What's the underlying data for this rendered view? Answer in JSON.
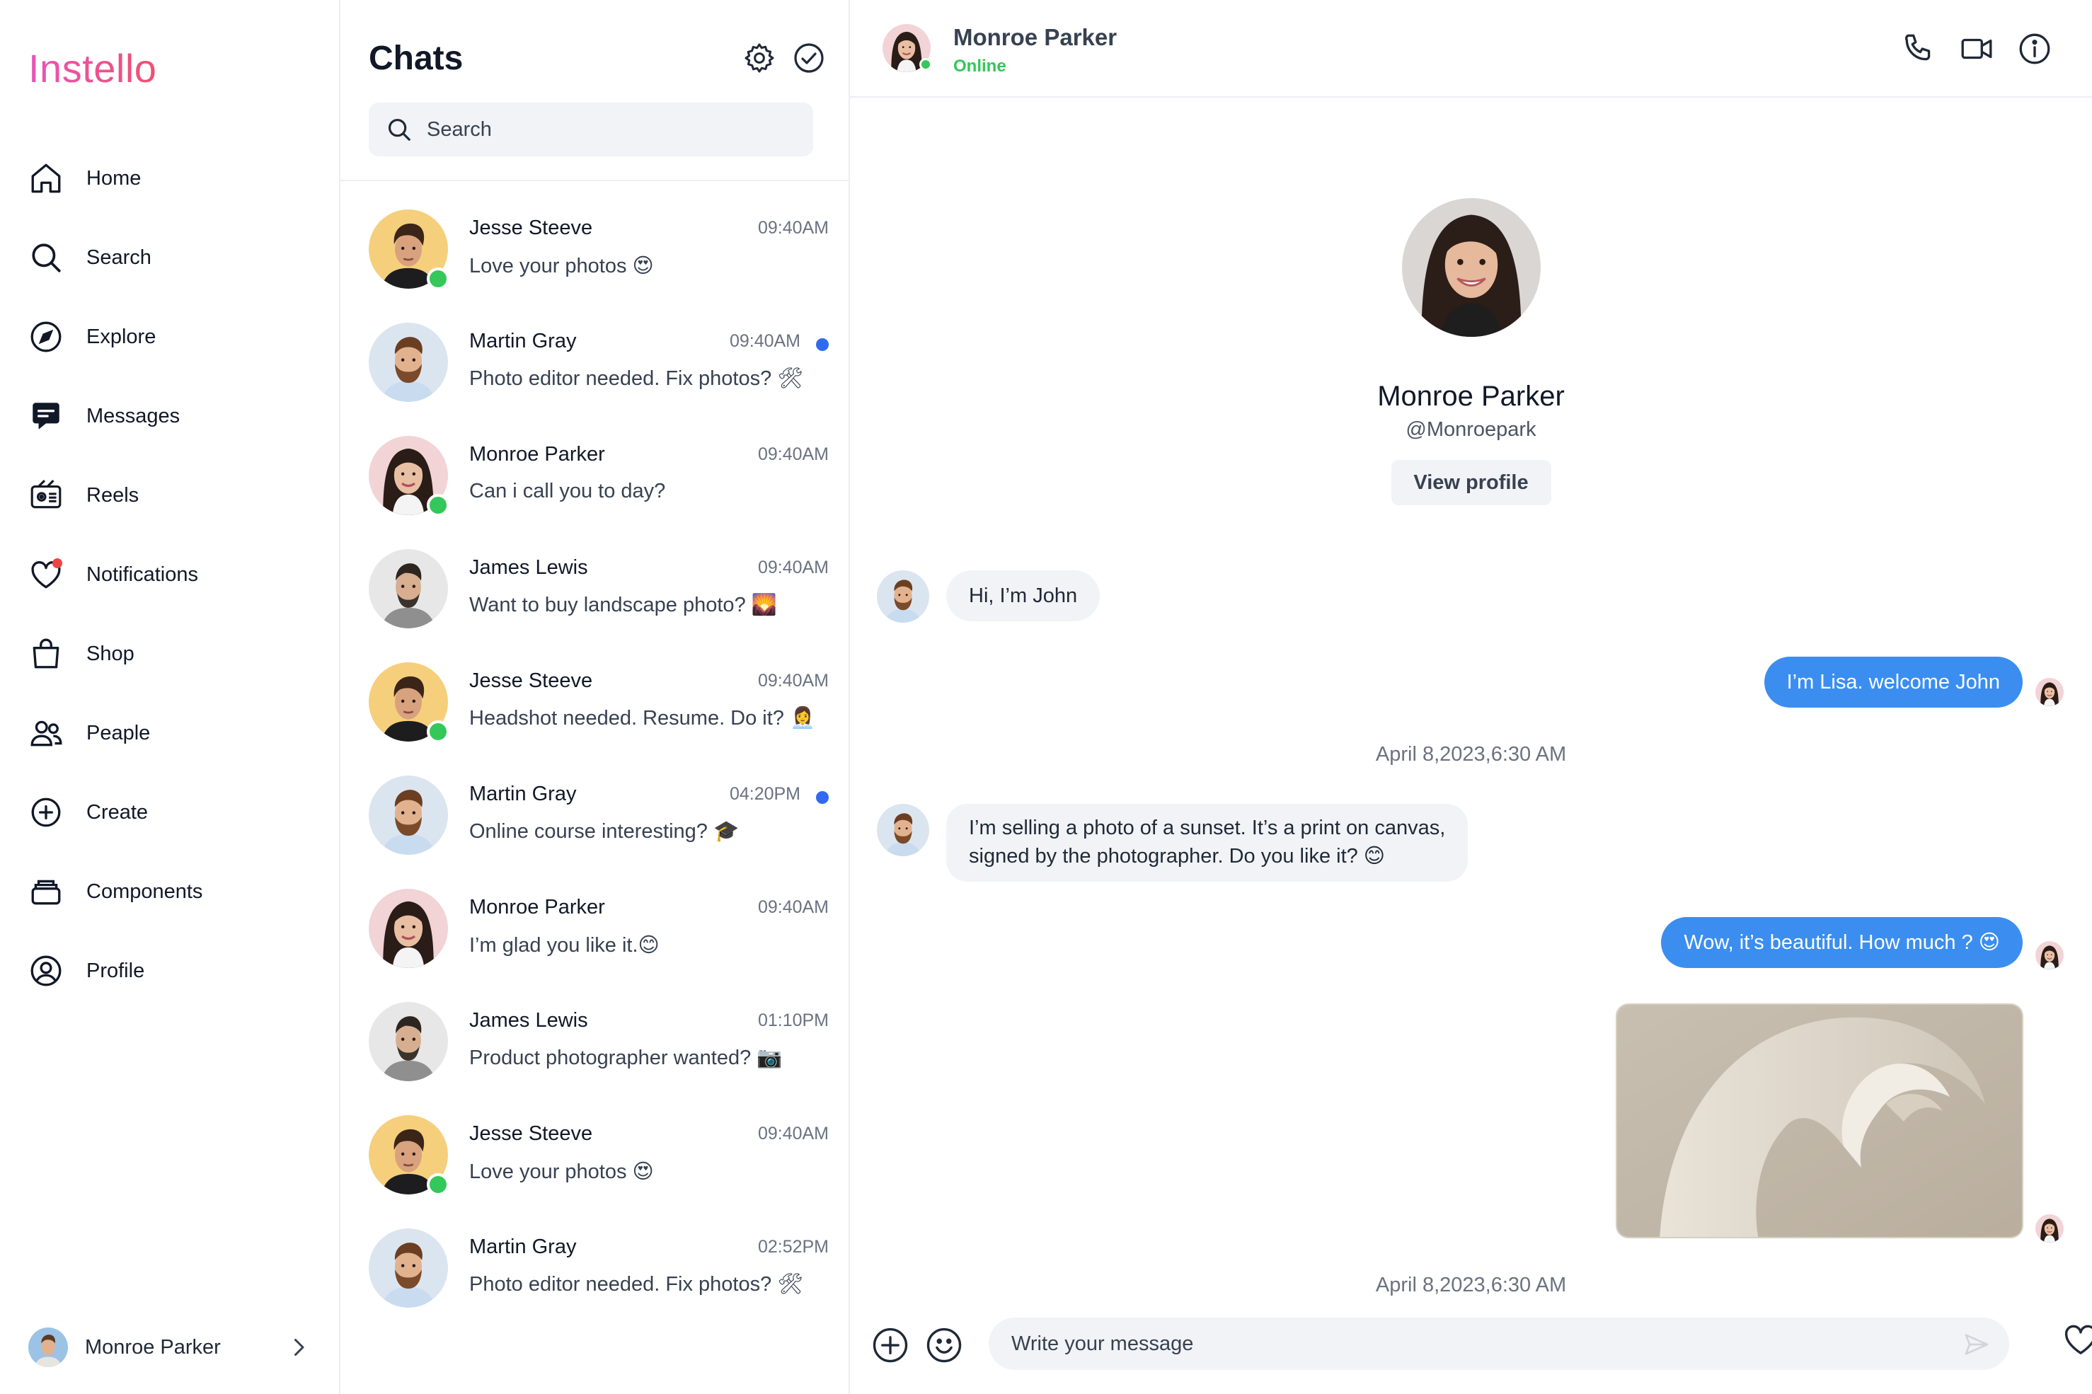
{
  "app": {
    "logo": "Instello"
  },
  "sidebar": {
    "items": [
      {
        "label": "Home",
        "icon": "home-icon"
      },
      {
        "label": "Search",
        "icon": "search-icon"
      },
      {
        "label": "Explore",
        "icon": "compass-icon"
      },
      {
        "label": "Messages",
        "icon": "chat-icon"
      },
      {
        "label": "Reels",
        "icon": "reels-icon"
      },
      {
        "label": "Notifications",
        "icon": "heart-icon"
      },
      {
        "label": "Shop",
        "icon": "bag-icon"
      },
      {
        "label": "Peaple",
        "icon": "people-icon"
      },
      {
        "label": "Create",
        "icon": "plus-circle-icon"
      },
      {
        "label": "Components",
        "icon": "stack-icon"
      },
      {
        "label": "Profile",
        "icon": "user-circle-icon"
      }
    ],
    "user": {
      "name": "Monroe Parker"
    }
  },
  "chatlist": {
    "title": "Chats",
    "search": {
      "placeholder": "Search"
    },
    "chats": [
      {
        "name": "Jesse Steeve",
        "time": "09:40AM",
        "preview": "Love your photos 😍",
        "online": true,
        "unread": false
      },
      {
        "name": "Martin Gray",
        "time": "09:40AM",
        "preview": "Photo editor needed. Fix photos? 🛠",
        "online": false,
        "unread": true
      },
      {
        "name": "Monroe Parker",
        "time": "09:40AM",
        "preview": "Can i call you to day?",
        "online": true,
        "unread": false
      },
      {
        "name": "James Lewis",
        "time": "09:40AM",
        "preview": "Want to buy landscape photo? 🌄",
        "online": false,
        "unread": false
      },
      {
        "name": "Jesse Steeve",
        "time": "09:40AM",
        "preview": "Headshot needed. Resume. Do it? 👩‍💼",
        "online": true,
        "unread": false
      },
      {
        "name": "Martin Gray",
        "time": "04:20PM",
        "preview": "Online course interesting? 🎓",
        "online": false,
        "unread": true
      },
      {
        "name": "Monroe Parker",
        "time": "09:40AM",
        "preview": "I’m glad you like it.😊",
        "online": false,
        "unread": false
      },
      {
        "name": "James Lewis",
        "time": "01:10PM",
        "preview": "Product photographer wanted? 📷",
        "online": false,
        "unread": false
      },
      {
        "name": "Jesse Steeve",
        "time": "09:40AM",
        "preview": "Love your photos 😍",
        "online": true,
        "unread": false
      },
      {
        "name": "Martin Gray",
        "time": "02:52PM",
        "preview": "Photo editor needed. Fix photos? 🛠",
        "online": false,
        "unread": false
      }
    ]
  },
  "conversation": {
    "contact": {
      "name": "Monroe Parker",
      "status": "Online",
      "handle": "@Monroepark"
    },
    "view_profile_label": "View profile",
    "messages": {
      "m1": "Hi, I’m John",
      "m2": "I’m Lisa. welcome John",
      "ts1": "April 8,2023,6:30 AM",
      "m3_line1": "I’m selling a photo of a sunset. It’s a print on canvas,",
      "m3_line2": "signed by the photographer. Do you like it? 😊",
      "m4": "Wow, it’s beautiful. How much ? 😍",
      "ts2": "April 8,2023,6:30 AM"
    },
    "composer": {
      "placeholder": "Write your message"
    }
  },
  "colors": {
    "accent": "#3b8ef0",
    "online": "#34c759",
    "unread": "#2f6bf0",
    "logo_start": "#e755b9",
    "logo_end": "#f0506e"
  }
}
